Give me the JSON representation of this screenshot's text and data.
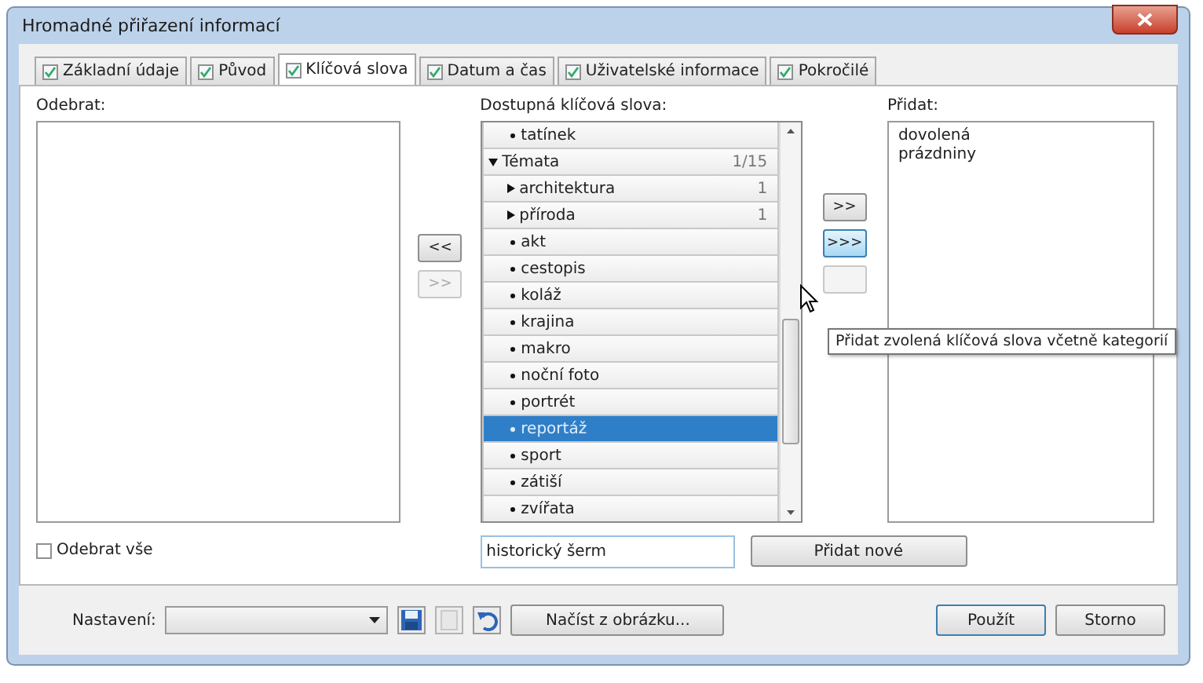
{
  "window": {
    "title": "Hromadné přiřazení informací"
  },
  "tabs": [
    {
      "label": "Základní údaje",
      "checked": true,
      "selected": false
    },
    {
      "label": "Původ",
      "checked": true,
      "selected": false
    },
    {
      "label": "Klíčová slova",
      "checked": true,
      "selected": true
    },
    {
      "label": "Datum a čas",
      "checked": true,
      "selected": false
    },
    {
      "label": "Uživatelské informace",
      "checked": true,
      "selected": false
    },
    {
      "label": "Pokročilé",
      "checked": true,
      "selected": false
    }
  ],
  "remove_list": {
    "label": "Odebrat:"
  },
  "move_buttons_left": [
    {
      "label": "<<",
      "disabled": false
    },
    {
      "label": ">>",
      "disabled": true
    }
  ],
  "available_list": {
    "label": "Dostupná klíčová slova:",
    "items": [
      {
        "kind": "keyword",
        "label": "tatínek",
        "selected": false
      },
      {
        "kind": "category",
        "label": "Témata",
        "count": "1/15",
        "expanded": true,
        "selected": false,
        "children": [
          {
            "kind": "category",
            "label": "architektura",
            "count": "1",
            "expanded": false,
            "selected": false
          },
          {
            "kind": "category",
            "label": "příroda",
            "count": "1",
            "expanded": false,
            "selected": false
          },
          {
            "kind": "keyword",
            "label": "akt",
            "selected": false
          },
          {
            "kind": "keyword",
            "label": "cestopis",
            "selected": false
          },
          {
            "kind": "keyword",
            "label": "koláž",
            "selected": false
          },
          {
            "kind": "keyword",
            "label": "krajina",
            "selected": false
          },
          {
            "kind": "keyword",
            "label": "makro",
            "selected": false
          },
          {
            "kind": "keyword",
            "label": "noční foto",
            "selected": false
          },
          {
            "kind": "keyword",
            "label": "portrét",
            "selected": false
          },
          {
            "kind": "keyword",
            "label": "reportáž",
            "selected": true
          },
          {
            "kind": "keyword",
            "label": "sport",
            "selected": false
          },
          {
            "kind": "keyword",
            "label": "zátiší",
            "selected": false
          },
          {
            "kind": "keyword",
            "label": "zvířata",
            "selected": false
          }
        ]
      }
    ]
  },
  "move_buttons_right": [
    {
      "label": ">>",
      "disabled": false,
      "hover": false
    },
    {
      "label": ">>>",
      "disabled": false,
      "hover": true
    },
    {
      "disabled": true,
      "hover": false
    }
  ],
  "tooltip": "Přidat zvolená klíčová slova včetně kategorií",
  "add_list": {
    "label": "Přidat:",
    "items": [
      "dovolená",
      "prázdniny"
    ]
  },
  "remove_all": {
    "label": "Odebrat vše",
    "checked": false
  },
  "new_keyword": {
    "value": "historický šerm"
  },
  "add_new_button": "Přidat nové",
  "footer": {
    "preset_label": "Nastavení:",
    "load_button": "Načíst z obrázku...",
    "apply_button": "Použít",
    "cancel_button": "Storno"
  }
}
